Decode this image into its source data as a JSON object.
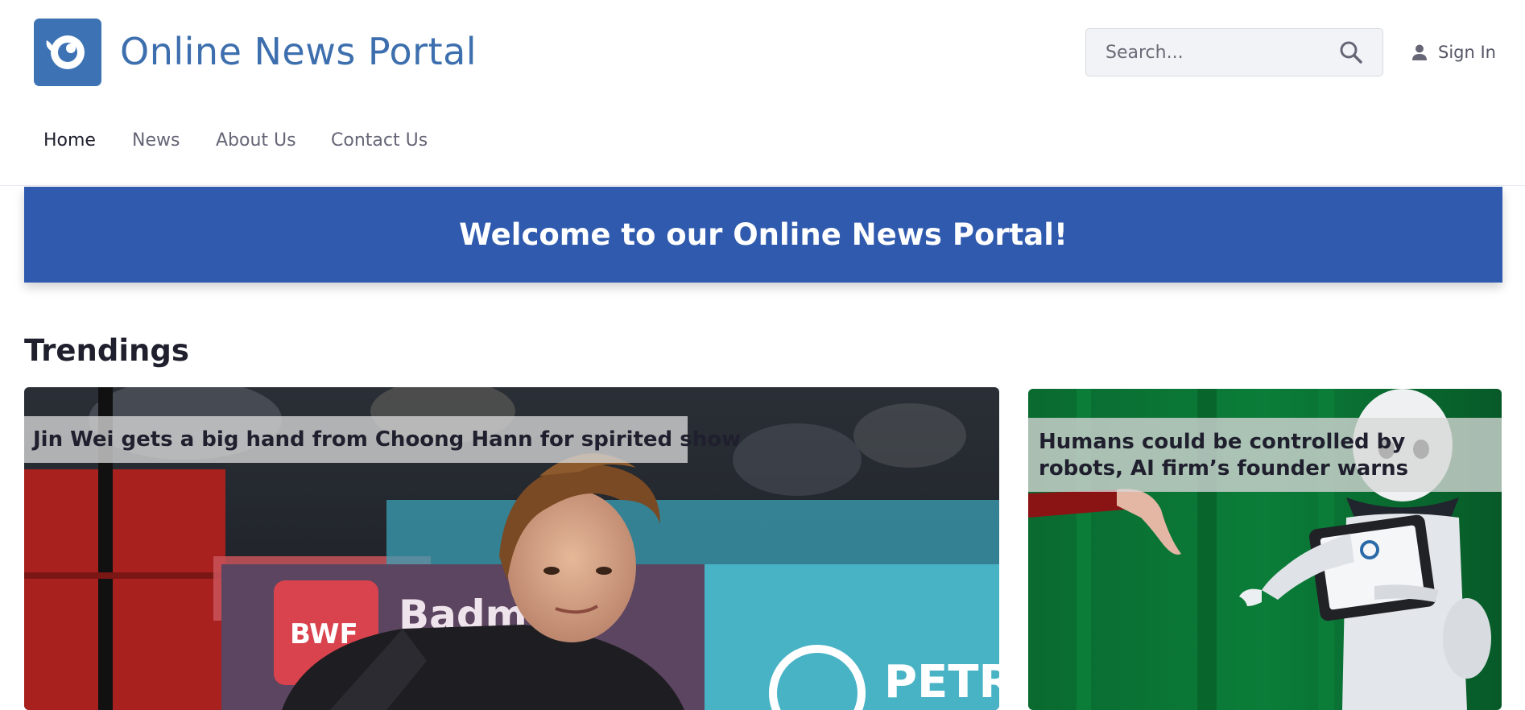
{
  "header": {
    "site_title": "Online News Portal",
    "logo_icon": "eye-logo-icon",
    "search": {
      "placeholder": "Search...",
      "value": "",
      "icon": "search-icon"
    },
    "signin": {
      "label": "Sign In",
      "icon": "user-icon"
    }
  },
  "nav": {
    "items": [
      {
        "label": "Home",
        "active": true
      },
      {
        "label": "News",
        "active": false
      },
      {
        "label": "About Us",
        "active": false
      },
      {
        "label": "Contact Us",
        "active": false
      }
    ]
  },
  "banner": {
    "title": "Welcome to our Online News Portal!"
  },
  "trending": {
    "heading": "Trendings",
    "articles": [
      {
        "headline": "Jin Wei gets a big hand from Choong Hann for spirited show",
        "image": "badminton-player-photo"
      },
      {
        "headline": "Humans could be controlled by robots, AI firm’s founder warns",
        "image": "robot-photo"
      }
    ]
  },
  "colors": {
    "brand": "#3d73b5",
    "banner": "#2f5aae",
    "caption_bg": "#d7d7d7",
    "nav_active": "#1f1f2e",
    "nav_inactive": "#666677"
  }
}
